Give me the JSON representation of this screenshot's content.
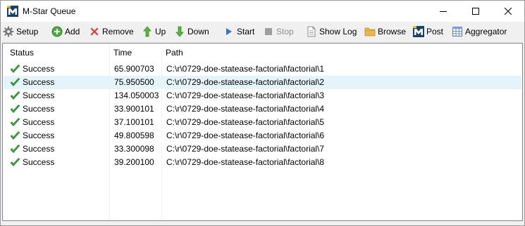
{
  "window": {
    "title": "M-Star Queue"
  },
  "toolbar": {
    "setup": "Setup",
    "add": "Add",
    "remove": "Remove",
    "up": "Up",
    "down": "Down",
    "start": "Start",
    "stop": "Stop",
    "show_log": "Show Log",
    "browse": "Browse",
    "post": "Post",
    "aggregator": "Aggregator"
  },
  "list": {
    "columns": {
      "status": "Status",
      "time": "Time",
      "path": "Path"
    },
    "selected_row": 1,
    "rows": [
      {
        "status": "Success",
        "time": "65.900703",
        "path": "C:\\r\\0729-doe-statease-factorial\\factorial\\1"
      },
      {
        "status": "Success",
        "time": "75.950500",
        "path": "C:\\r\\0729-doe-statease-factorial\\factorial\\2"
      },
      {
        "status": "Success",
        "time": "134.050003",
        "path": "C:\\r\\0729-doe-statease-factorial\\factorial\\3"
      },
      {
        "status": "Success",
        "time": "33.900101",
        "path": "C:\\r\\0729-doe-statease-factorial\\factorial\\4"
      },
      {
        "status": "Success",
        "time": "37.100101",
        "path": "C:\\r\\0729-doe-statease-factorial\\factorial\\5"
      },
      {
        "status": "Success",
        "time": "49.800598",
        "path": "C:\\r\\0729-doe-statease-factorial\\factorial\\6"
      },
      {
        "status": "Success",
        "time": "33.300098",
        "path": "C:\\r\\0729-doe-statease-factorial\\factorial\\7"
      },
      {
        "status": "Success",
        "time": "39.200100",
        "path": "C:\\r\\0729-doe-statease-factorial\\factorial\\8"
      }
    ]
  }
}
